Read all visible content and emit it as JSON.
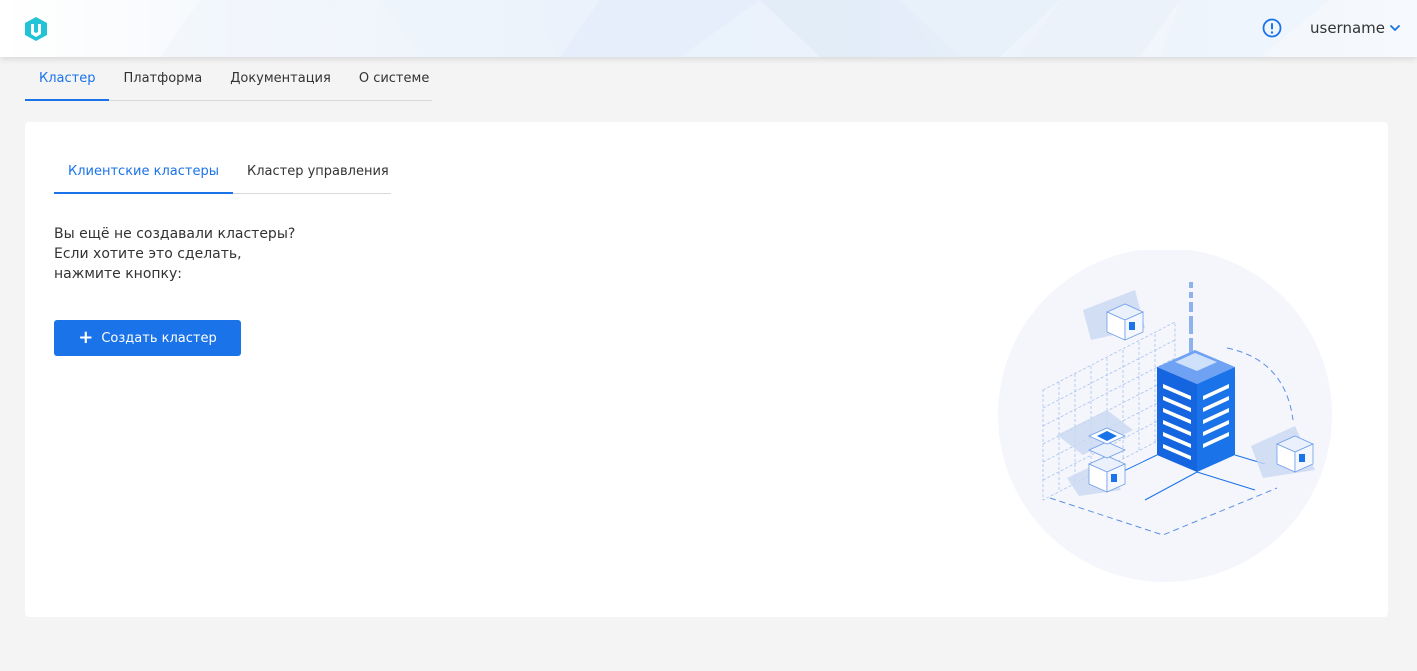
{
  "header": {
    "user_name": "username",
    "icons": {
      "logo": "logo-icon",
      "alert": "alert-icon",
      "dropdown": "chevron-down-icon"
    }
  },
  "top_nav": {
    "tabs": [
      {
        "label": "Кластер",
        "active": true
      },
      {
        "label": "Платформа",
        "active": false
      },
      {
        "label": "Документация",
        "active": false
      },
      {
        "label": "О системе",
        "active": false
      }
    ]
  },
  "cluster_page": {
    "sub_tabs": [
      {
        "label": "Клиентские кластеры",
        "active": true
      },
      {
        "label": "Кластер управления",
        "active": false
      }
    ],
    "empty_state": {
      "lines": [
        "Вы ещё не создавали кластеры?",
        "Если хотите это сделать,",
        "нажмите кнопку:"
      ],
      "create_button_label": "Создать кластер",
      "create_button_icon": "plus-icon",
      "illustration": "server-tower-illustration"
    }
  },
  "colors": {
    "accent": "#1a73e8",
    "logo_teal": "#21c3d6",
    "page_background": "#f4f4f4",
    "card_background": "#ffffff"
  }
}
